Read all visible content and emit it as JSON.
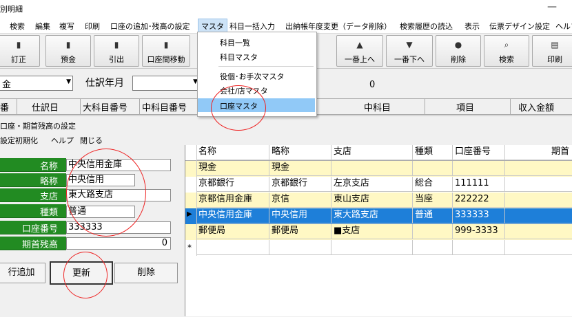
{
  "window": {
    "title": "別明細",
    "minimize": "—"
  },
  "menu": [
    "検索",
    "編集",
    "複写",
    "印刷",
    "口座の追加･残高の設定",
    "マスタ",
    "科目一括入力",
    "出納帳年度変更（データ削除）",
    "検索履歴の読込",
    "表示",
    "伝票デザイン設定",
    "ヘルプ"
  ],
  "toolbar": {
    "deposit": "預金",
    "withdraw": "引出",
    "transfer": "口座間移動",
    "correct": "訂正",
    "top_up": "一番上へ",
    "bottom": "一番下へ",
    "delete": "削除",
    "search": "検索",
    "print": "印刷",
    "icon_up": "▲",
    "icon_down": "▼"
  },
  "filter": {
    "account_value": "金",
    "journal_month_label": "仕訳年月",
    "count": "0"
  },
  "columns": [
    "番",
    "仕訳日",
    "大科目番号",
    "中科目番号",
    "中科目",
    "項目",
    "収入金額"
  ],
  "dropdown": {
    "items": [
      "科目一覧",
      "科目マスタ",
      "役個･お手次マスタ",
      "会社/店マスタ",
      "口座マスタ"
    ],
    "selected": "口座マスタ"
  },
  "subwindow": {
    "title": "口座・期首残高の設定",
    "menu": [
      "設定初期化",
      "ヘルプ",
      "閉じる"
    ],
    "form": {
      "name_label": "名称",
      "name": "中央信用金庫",
      "abbr_label": "略称",
      "abbr": "中央信用",
      "branch_label": "支店",
      "branch": "東大路支店",
      "type_label": "種類",
      "type": "普通",
      "acct_label": "口座番号",
      "acct": "333333",
      "opening_label": "期首残高",
      "opening": "0"
    },
    "buttons": {
      "add_row": "行追加",
      "update": "更新",
      "delete": "削除"
    },
    "grid": {
      "headers": [
        "名称",
        "略称",
        "支店",
        "種類",
        "口座番号",
        "期首"
      ],
      "rows": [
        [
          "現金",
          "現金",
          "",
          "",
          "",
          ""
        ],
        [
          "京都銀行",
          "京都銀行",
          "左京支店",
          "総合",
          "111111",
          ""
        ],
        [
          "京都信用金庫",
          "京信",
          "東山支店",
          "当座",
          "222222",
          ""
        ],
        [
          "中央信用金庫",
          "中央信用",
          "東大路支店",
          "普通",
          "333333",
          ""
        ],
        [
          "郵便局",
          "郵便局",
          "■支店",
          "",
          "999-3333",
          ""
        ]
      ],
      "current_marker": "▶",
      "new_marker": "*"
    }
  },
  "colors": {
    "label_green": "#228b22",
    "selection_blue": "#1e7fd9",
    "highlight_yellow": "#fff8c4",
    "annotation_red": "#e22222"
  }
}
